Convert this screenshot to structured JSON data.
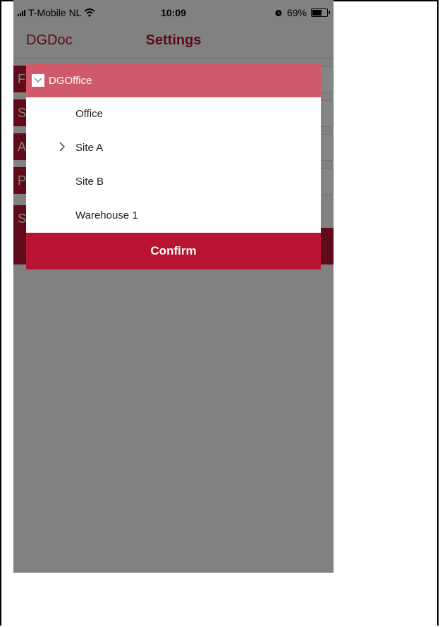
{
  "status_bar": {
    "carrier": "T-Mobile NL",
    "time": "10:09",
    "battery_percent": "69%",
    "battery_level": 0.69
  },
  "navbar": {
    "back_label": "DGDoc",
    "title": "Settings"
  },
  "background_rows": [
    "F",
    "S",
    "A",
    "P",
    "S"
  ],
  "dialog": {
    "root_label": "DGOffice",
    "items": [
      {
        "label": "Office",
        "expandable": false
      },
      {
        "label": "Site A",
        "expandable": true
      },
      {
        "label": "Site B",
        "expandable": false
      },
      {
        "label": "Warehouse 1",
        "expandable": false
      }
    ],
    "confirm_label": "Confirm"
  },
  "colors": {
    "accent": "#b81432",
    "header_pink": "#d05a6c",
    "overlay": "#808080"
  }
}
